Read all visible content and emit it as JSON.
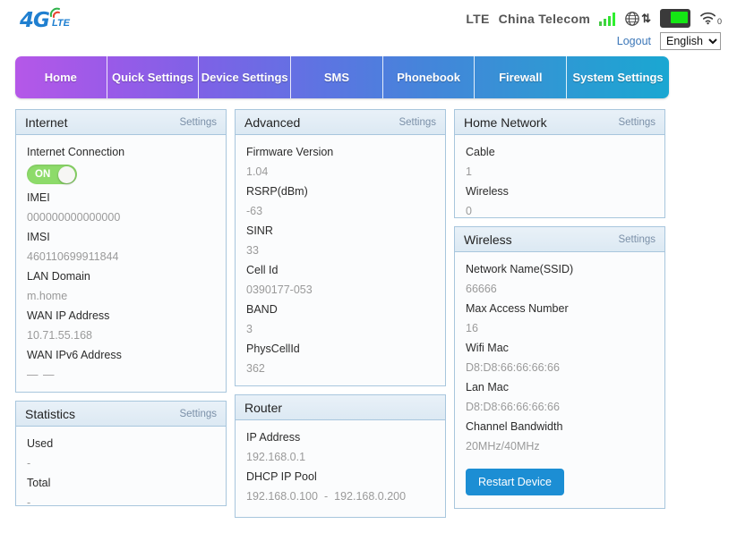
{
  "header": {
    "logo_main": "4G",
    "logo_sub": "LTE",
    "network_mode": "LTE",
    "carrier": "China Telecom",
    "logout_label": "Logout",
    "language_selected": "English",
    "language_options": [
      "English"
    ],
    "icons": {
      "signal": "signal-bars-icon",
      "globe": "globe-icon",
      "transfer": "up-down-arrows-icon",
      "battery": "battery-icon",
      "wifi": "wifi-icon",
      "wifi_client_count": "0"
    }
  },
  "nav": {
    "tabs": [
      {
        "label": "Home",
        "active": true
      },
      {
        "label": "Quick Settings",
        "active": false
      },
      {
        "label": "Device Settings",
        "active": false
      },
      {
        "label": "SMS",
        "active": false
      },
      {
        "label": "Phonebook",
        "active": false
      },
      {
        "label": "Firewall",
        "active": false
      },
      {
        "label": "System Settings",
        "active": false
      }
    ]
  },
  "panels": {
    "internet": {
      "title": "Internet",
      "settings_label": "Settings",
      "connection_label": "Internet Connection",
      "toggle_state": "ON",
      "fields": [
        {
          "label": "IMEI",
          "value": "000000000000000"
        },
        {
          "label": "IMSI",
          "value": "460110699911844"
        },
        {
          "label": "LAN Domain",
          "value": "m.home"
        },
        {
          "label": "WAN IP Address",
          "value": "10.71.55.168"
        },
        {
          "label": "WAN IPv6 Address",
          "value": "— —"
        }
      ]
    },
    "statistics": {
      "title": "Statistics",
      "settings_label": "Settings",
      "fields": [
        {
          "label": "Used",
          "value": "-"
        },
        {
          "label": "Total",
          "value": "-"
        }
      ]
    },
    "advanced": {
      "title": "Advanced",
      "settings_label": "Settings",
      "fields": [
        {
          "label": "Firmware Version",
          "value": "1.04"
        },
        {
          "label": "RSRP(dBm)",
          "value": "-63"
        },
        {
          "label": "SINR",
          "value": "33"
        },
        {
          "label": "Cell Id",
          "value": "0390177-053"
        },
        {
          "label": "BAND",
          "value": "3"
        },
        {
          "label": "PhysCellId",
          "value": "362"
        }
      ]
    },
    "router": {
      "title": "Router",
      "fields": [
        {
          "label": "IP Address",
          "value": "192.168.0.1"
        }
      ],
      "dhcp_label": "DHCP IP Pool",
      "dhcp_start": "192.168.0.100",
      "dhcp_separator": "-",
      "dhcp_end": "192.168.0.200"
    },
    "home_network": {
      "title": "Home Network",
      "settings_label": "Settings",
      "fields": [
        {
          "label": "Cable",
          "value": "1"
        },
        {
          "label": "Wireless",
          "value": "0"
        }
      ]
    },
    "wireless": {
      "title": "Wireless",
      "settings_label": "Settings",
      "fields": [
        {
          "label": "Network Name(SSID)",
          "value": "66666"
        },
        {
          "label": "Max Access Number",
          "value": "16"
        },
        {
          "label": "Wifi Mac",
          "value": "D8:D8:66:66:66:66"
        },
        {
          "label": "Lan Mac",
          "value": "D8:D8:66:66:66:66"
        },
        {
          "label": "Channel Bandwidth",
          "value": "20MHz/40MHz"
        }
      ],
      "restart_label": "Restart Device"
    }
  },
  "colors": {
    "accent_blue": "#1c8ed4",
    "toggle_green": "#8ddb6a",
    "panel_border": "#a8c6dd",
    "nav_gradient_start": "#b558e8",
    "nav_gradient_end": "#1aa7d2",
    "signal_green": "#2ff02f"
  }
}
